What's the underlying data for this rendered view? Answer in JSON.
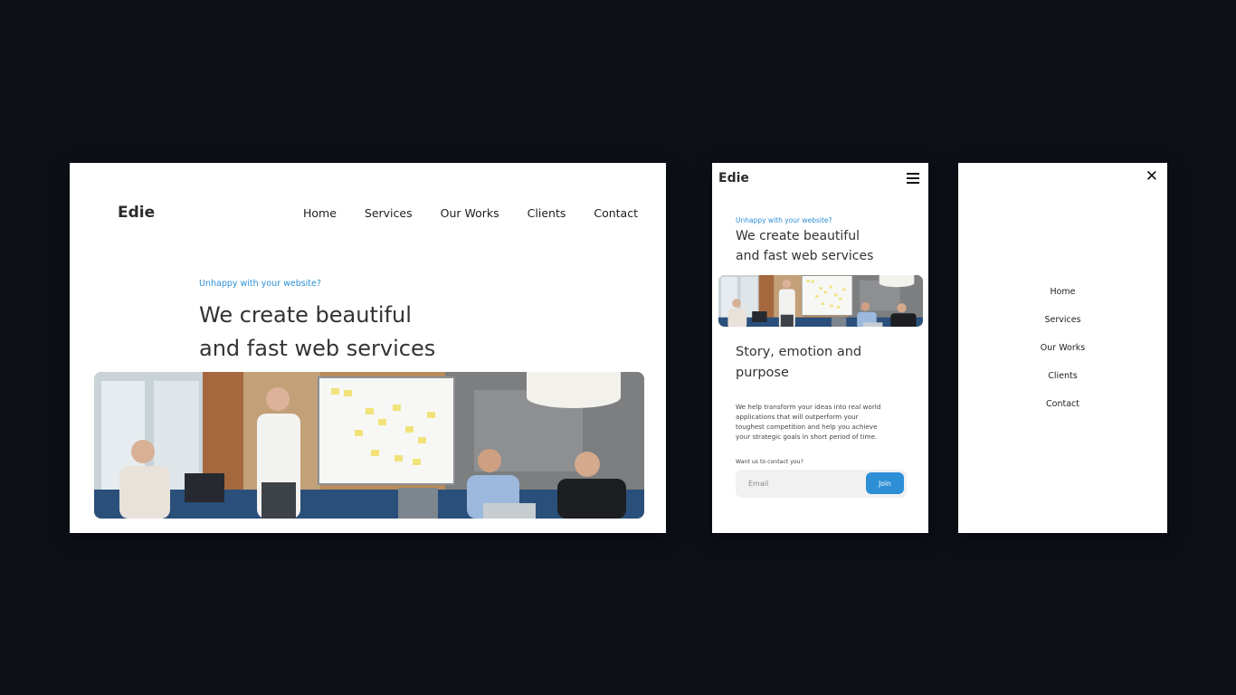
{
  "desktop": {
    "logo": "Edie",
    "nav": [
      "Home",
      "Services",
      "Our Works",
      "Clients",
      "Contact"
    ],
    "kicker": "Unhappy with your website?",
    "headline_line1": "We create beautiful",
    "headline_line2": "and fast web services",
    "hero_image": "office-meeting-photo"
  },
  "mobile": {
    "logo": "Edie",
    "menu_icon": "hamburger-icon",
    "kicker": "Unhappy with your website?",
    "headline_line1": "We create beautiful",
    "headline_line2": "and fast web services",
    "hero_image": "office-meeting-photo",
    "subheading_line1": "Story, emotion and",
    "subheading_line2": "purpose",
    "body_line1": "We help transform your ideas into real world",
    "body_line2": "applications that will outperform your",
    "body_line3": "toughest competition and help you achieve",
    "body_line4": "your strategic goals in short period of time.",
    "contact_prompt": "Want us to contact you?",
    "email_placeholder": "Email",
    "join_label": "Join"
  },
  "menu": {
    "close_icon": "close-icon",
    "items": [
      "Home",
      "Services",
      "Our Works",
      "Clients",
      "Contact"
    ]
  },
  "colors": {
    "background": "#0d1017",
    "accent": "#2d8fd6",
    "text": "#333333"
  }
}
